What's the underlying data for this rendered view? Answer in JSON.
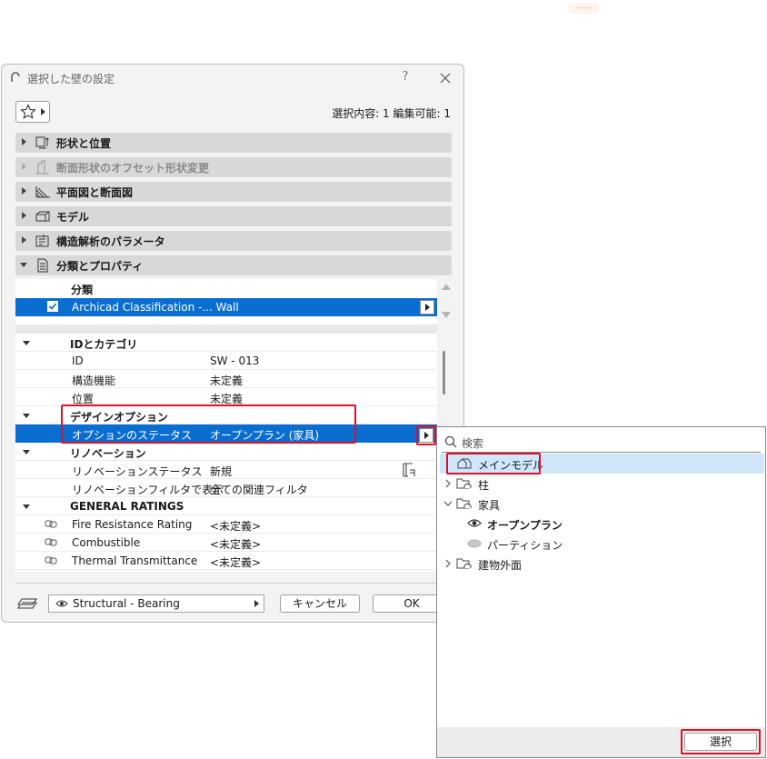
{
  "decoration": {
    "dashes": "----"
  },
  "dialog": {
    "title": "選択した壁の設定",
    "help": "?",
    "selection_info": "選択内容: 1 編集可能: 1"
  },
  "panels": [
    {
      "label": "形状と位置",
      "icon": "shape-position-icon",
      "state": "collapsed"
    },
    {
      "label": "断面形状のオフセット形状変更",
      "icon": "profile-offset-icon",
      "state": "disabled"
    },
    {
      "label": "平面図と断面図",
      "icon": "floorplan-section-icon",
      "state": "collapsed"
    },
    {
      "label": "モデル",
      "icon": "model-icon",
      "state": "collapsed"
    },
    {
      "label": "構造解析のパラメータ",
      "icon": "structural-analysis-icon",
      "state": "collapsed"
    },
    {
      "label": "分類とプロパティ",
      "icon": "document-icon",
      "state": "expanded"
    }
  ],
  "classification": {
    "header": "分類",
    "row": "Archicad Classification -... Wall"
  },
  "properties": {
    "id_group": "IDとカテゴリ",
    "id_key": "ID",
    "id_value": "SW - 013",
    "struct_key": "構造機能",
    "struct_value": "未定義",
    "pos_key": "位置",
    "pos_value": "未定義",
    "design_group": "デザインオプション",
    "option_key": "オプションのステータス",
    "option_value": "オープンプラン (家具)",
    "renov_group": "リノベーション",
    "renov_status_key": "リノベーションステータス",
    "renov_status_value": "新規",
    "renov_filter_key": "リノベーションフィルタで表示",
    "renov_filter_value": "全ての関連フィルタ",
    "ratings_group": "GENERAL RATINGS",
    "fire_key": "Fire Resistance Rating",
    "fire_value": "<未定義>",
    "comb_key": "Combustible",
    "comb_value": "<未定義>",
    "thermal_key": "Thermal Transmittance",
    "thermal_value": "<未定義>"
  },
  "footer": {
    "layer": "Structural - Bearing",
    "cancel": "キャンセル",
    "ok": "OK"
  },
  "popup": {
    "search_placeholder": "検索",
    "tree": [
      {
        "label": "メインモデル",
        "icon": "house-icon",
        "bold": false
      },
      {
        "label": "柱",
        "icon": "folder-icon",
        "bold": false
      },
      {
        "label": "家具",
        "icon": "folder-icon",
        "bold": false
      },
      {
        "label": "オープンプラン",
        "icon": "eye-icon",
        "bold": true
      },
      {
        "label": "パーティション",
        "icon": "ellipse-icon",
        "bold": false
      },
      {
        "label": "建物外面",
        "icon": "folder-icon",
        "bold": false
      }
    ],
    "select_button": "選択"
  },
  "colors": {
    "selection": "#0a6ed1",
    "highlight": "#e0102a",
    "tree_highlight": "#cfe6fb"
  }
}
